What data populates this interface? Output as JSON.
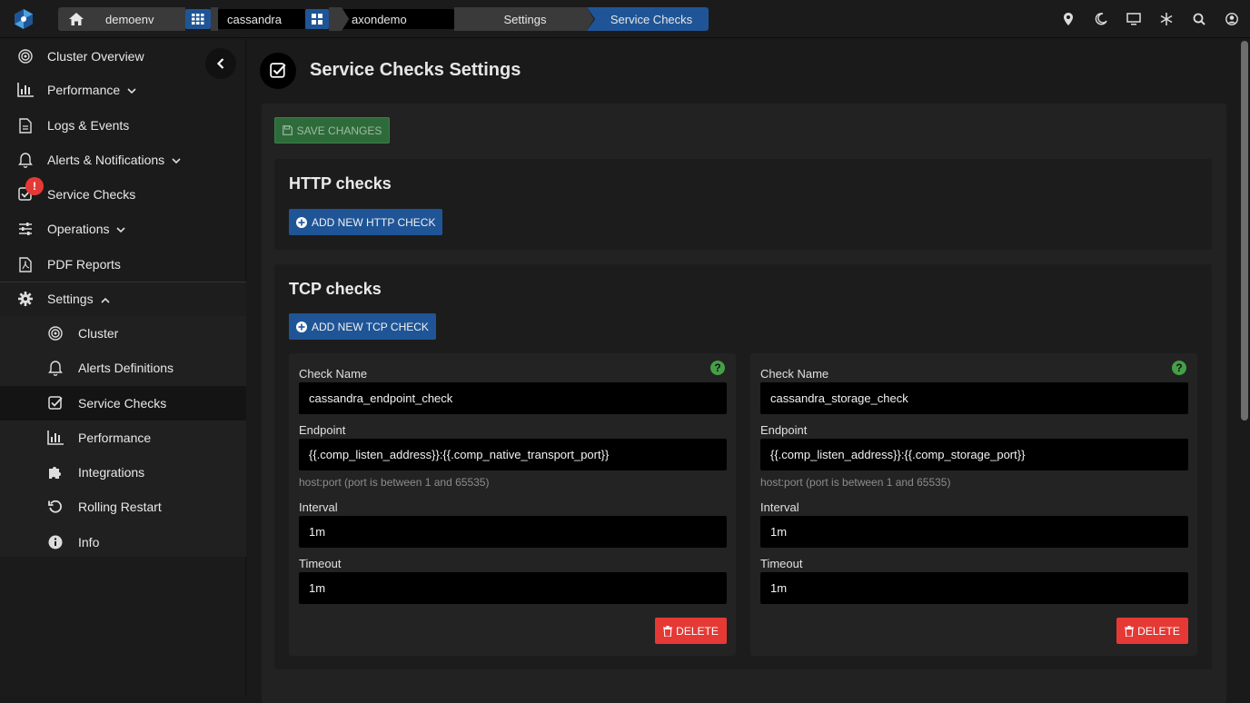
{
  "colors": {
    "accent": "#1f5596",
    "success": "#2e6b3a",
    "danger": "#e53935",
    "help": "#43a047"
  },
  "breadcrumb": {
    "environment": "demoenv",
    "cluster": "cassandra",
    "workspace": "axondemo",
    "section": "Settings",
    "page": "Service Checks"
  },
  "topbar_icons": [
    "map-pin-icon",
    "moon-icon",
    "monitor-icon",
    "snowflake-icon",
    "search-icon",
    "user-icon"
  ],
  "sidebar": {
    "items": [
      {
        "label": "Cluster Overview",
        "icon": "target-icon"
      },
      {
        "label": "Performance",
        "icon": "bar-chart-icon"
      },
      {
        "label": "Logs & Events",
        "icon": "document-icon"
      },
      {
        "label": "Alerts & Notifications",
        "icon": "bell-icon"
      },
      {
        "label": "Service Checks",
        "icon": "checkbox-icon",
        "badge": "!"
      },
      {
        "label": "Operations",
        "icon": "sliders-icon"
      },
      {
        "label": "PDF Reports",
        "icon": "pdf-icon"
      },
      {
        "label": "Settings",
        "icon": "gear-icon"
      }
    ],
    "settings_items": [
      {
        "label": "Cluster",
        "icon": "target-icon"
      },
      {
        "label": "Alerts Definitions",
        "icon": "bell-icon"
      },
      {
        "label": "Service Checks",
        "icon": "checkbox-icon"
      },
      {
        "label": "Performance",
        "icon": "bar-chart-icon"
      },
      {
        "label": "Integrations",
        "icon": "puzzle-icon"
      },
      {
        "label": "Rolling Restart",
        "icon": "restart-icon"
      },
      {
        "label": "Info",
        "icon": "info-icon"
      }
    ]
  },
  "main": {
    "title": "Service Checks Settings",
    "save_label": "SAVE CHANGES",
    "http": {
      "title": "HTTP checks",
      "add_label": "ADD NEW HTTP CHECK"
    },
    "tcp": {
      "title": "TCP checks",
      "add_label": "ADD NEW TCP CHECK",
      "labels": {
        "name": "Check Name",
        "endpoint": "Endpoint",
        "hint": "host:port (port is between 1 and 65535)",
        "interval": "Interval",
        "timeout": "Timeout",
        "delete": "DELETE",
        "help": "?"
      },
      "checks": [
        {
          "name": "cassandra_endpoint_check",
          "endpoint": "{{.comp_listen_address}}:{{.comp_native_transport_port}}",
          "interval": "1m",
          "timeout": "1m"
        },
        {
          "name": "cassandra_storage_check",
          "endpoint": "{{.comp_listen_address}}:{{.comp_storage_port}}",
          "interval": "1m",
          "timeout": "1m"
        }
      ]
    }
  }
}
